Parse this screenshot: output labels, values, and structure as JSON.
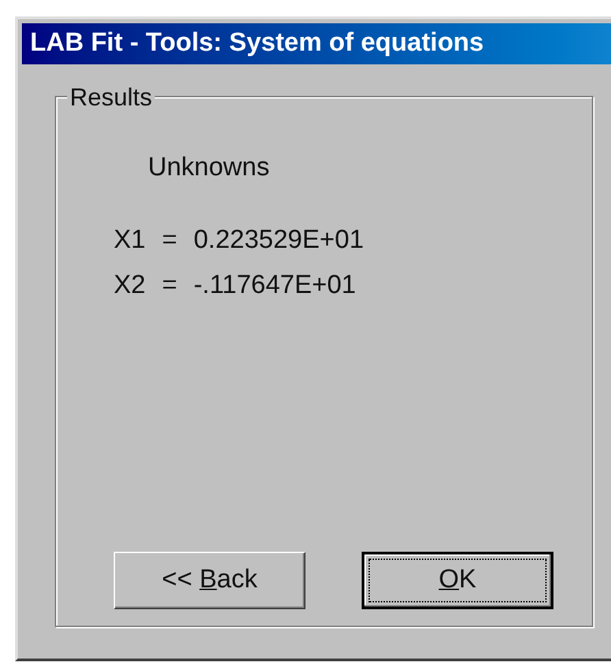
{
  "window": {
    "title": "LAB Fit - Tools: System of equations"
  },
  "group": {
    "label": "Results",
    "heading": "Unknowns",
    "rows": [
      {
        "name": "X1",
        "sign": "=",
        "value": "0.223529E+01"
      },
      {
        "name": "X2",
        "sign": "=",
        "value": "-.117647E+01"
      }
    ]
  },
  "buttons": [
    {
      "before": "<< ",
      "mnemonic": "B",
      "after": "ack",
      "default": false
    },
    {
      "mnemonic": "O",
      "after": "K",
      "default": true
    }
  ]
}
